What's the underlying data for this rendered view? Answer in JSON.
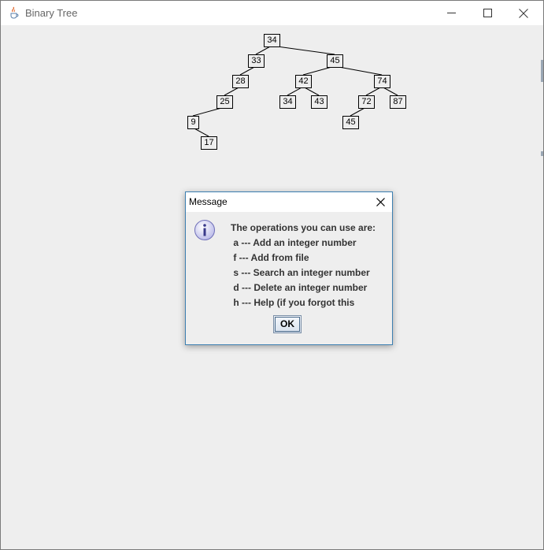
{
  "window": {
    "title": "Binary Tree"
  },
  "tree": {
    "nodes": [
      {
        "id": "n34a",
        "label": "34"
      },
      {
        "id": "n33",
        "label": "33"
      },
      {
        "id": "n45a",
        "label": "45"
      },
      {
        "id": "n28",
        "label": "28"
      },
      {
        "id": "n42",
        "label": "42"
      },
      {
        "id": "n74",
        "label": "74"
      },
      {
        "id": "n25",
        "label": "25"
      },
      {
        "id": "n34b",
        "label": "34"
      },
      {
        "id": "n43",
        "label": "43"
      },
      {
        "id": "n72",
        "label": "72"
      },
      {
        "id": "n87",
        "label": "87"
      },
      {
        "id": "n9",
        "label": "9"
      },
      {
        "id": "n45b",
        "label": "45"
      },
      {
        "id": "n17",
        "label": "17"
      }
    ]
  },
  "dialog": {
    "title": "Message",
    "lines": [
      "The operations you can use are:",
      " a --- Add an integer number",
      " f --- Add from file",
      " s --- Search an integer number",
      " d --- Delete an integer number",
      " h --- Help (if you forgot this"
    ],
    "ok_label": "OK"
  },
  "icons": {
    "app": "java-cup-icon",
    "info": "info-icon"
  }
}
